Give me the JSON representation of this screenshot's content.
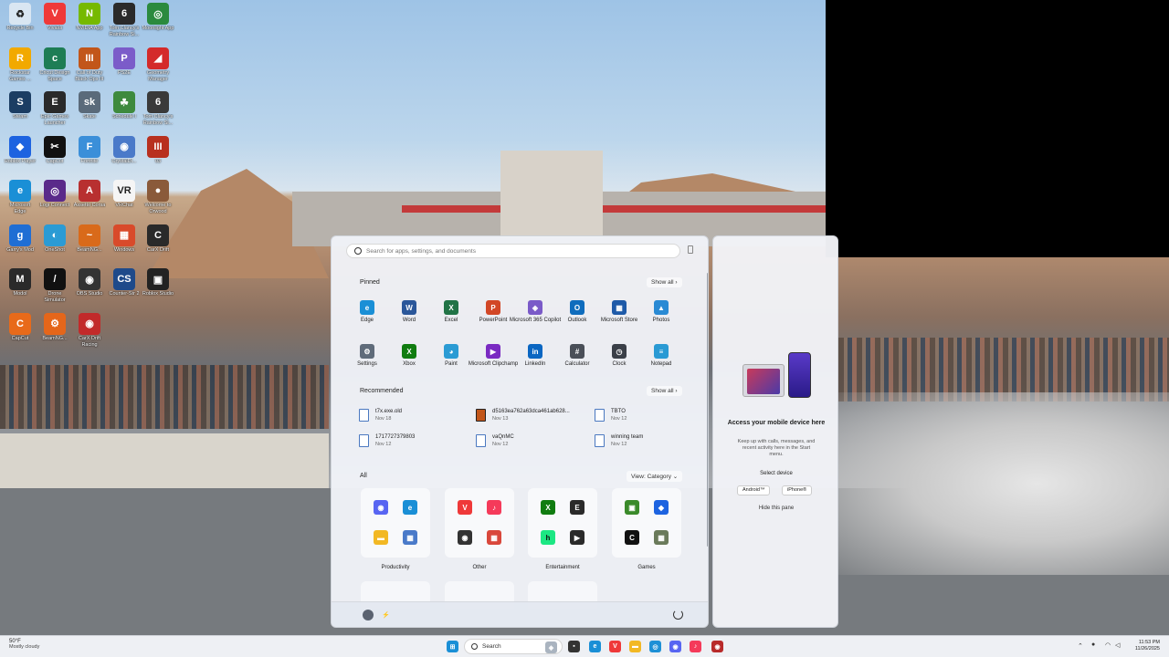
{
  "desktop": {
    "icons": [
      {
        "label": "Recycle Bin",
        "glyph": "♻",
        "color": "#d9e6f2",
        "icon": "recycle-bin-icon"
      },
      {
        "label": "Vivaldi",
        "glyph": "V",
        "color": "#ef3939",
        "icon": "vivaldi-icon"
      },
      {
        "label": "NVIDIA App",
        "glyph": "N",
        "color": "#76b900",
        "icon": "nvidia-icon"
      },
      {
        "label": "Tom Clancy's Rainbow Si...",
        "glyph": "6",
        "color": "#2a2a2a",
        "icon": "rainbow-six-icon"
      },
      {
        "label": "Moonlight App",
        "glyph": "◎",
        "color": "#2b8a3e",
        "icon": "moonlight-icon"
      },
      {
        "label": "Rockstar Games ...",
        "glyph": "R",
        "color": "#f2a900",
        "icon": "rockstar-icon"
      },
      {
        "label": "Cricut Design Space",
        "glyph": "c",
        "color": "#1e7d55",
        "icon": "cricut-icon"
      },
      {
        "label": "Call of Duty Black Ops III",
        "glyph": "III",
        "color": "#c2561a",
        "icon": "cod-icon"
      },
      {
        "label": "PS2E",
        "glyph": "P",
        "color": "#7b5cc9",
        "icon": "ps2e-icon"
      },
      {
        "label": "Geometry Manager",
        "glyph": "◢",
        "color": "#d42a2a",
        "icon": "geometry-icon"
      },
      {
        "label": "Steam",
        "glyph": "S",
        "color": "#1b3d63",
        "icon": "steam-icon"
      },
      {
        "label": "Epic Games Launcher",
        "glyph": "E",
        "color": "#2a2a2a",
        "icon": "epic-games-icon"
      },
      {
        "label": "Skate",
        "glyph": "sk",
        "color": "#5a6a7a",
        "icon": "skate-icon"
      },
      {
        "label": "Schedule I",
        "glyph": "☘",
        "color": "#3e8a3e",
        "icon": "schedule-icon"
      },
      {
        "label": "Tom Clancy's Rainbow Si...",
        "glyph": "6",
        "color": "#3a3a3a",
        "icon": "rainbow-six-icon-2"
      },
      {
        "label": "Roblox Player",
        "glyph": "◆",
        "color": "#1d63e0",
        "icon": "roblox-icon"
      },
      {
        "label": "CapCut",
        "glyph": "✂",
        "color": "#111111",
        "icon": "capcut-icon"
      },
      {
        "label": "Fortnite",
        "glyph": "F",
        "color": "#3b8fd9",
        "icon": "fortnite-icon"
      },
      {
        "label": "CrystalDi...",
        "glyph": "◉",
        "color": "#4a7ac9",
        "icon": "crystaldisk-icon"
      },
      {
        "label": "03",
        "glyph": "III",
        "color": "#b8301f",
        "icon": "ops-icon"
      },
      {
        "label": "Microsoft Edge",
        "glyph": "e",
        "color": "#1a8fd6",
        "icon": "edge-icon"
      },
      {
        "label": "Logi Connect",
        "glyph": "◎",
        "color": "#5a2a8a",
        "icon": "logi-icon"
      },
      {
        "label": "Assetto Corsa",
        "glyph": "A",
        "color": "#b83030",
        "icon": "assetto-icon"
      },
      {
        "label": "VRChat",
        "glyph": "VR",
        "color": "#f5f5f5",
        "icon": "vrchat-icon"
      },
      {
        "label": "Welcome to Orwood",
        "glyph": "●",
        "color": "#8a5a3a",
        "icon": "welcome-icon"
      },
      {
        "label": "Garry's Mod",
        "glyph": "g",
        "color": "#1f6ed4",
        "icon": "gmod-icon"
      },
      {
        "label": "OneShot",
        "glyph": "◐",
        "color": "#2b9bd4",
        "icon": "oneshot-icon"
      },
      {
        "label": "BeamNG...",
        "glyph": "~",
        "color": "#d96a1a",
        "icon": "beamng-icon"
      },
      {
        "label": "Windows",
        "glyph": "▦",
        "color": "#d94a2a",
        "icon": "windows-app-icon"
      },
      {
        "label": "CarX Drift",
        "glyph": "C",
        "color": "#2a2a2a",
        "icon": "carx-icon"
      },
      {
        "label": "Modol",
        "glyph": "M",
        "color": "#2a2a2a",
        "icon": "modol-icon"
      },
      {
        "label": "Drone Simulator",
        "glyph": "/",
        "color": "#111111",
        "icon": "drone-icon"
      },
      {
        "label": "OBS Studio",
        "glyph": "◉",
        "color": "#333333",
        "icon": "obs-icon"
      },
      {
        "label": "Counter-Str 2",
        "glyph": "CS",
        "color": "#1e4a8a",
        "icon": "cs2-icon"
      },
      {
        "label": "Roblox Studio",
        "glyph": "▣",
        "color": "#222222",
        "icon": "roblox-studio-icon"
      },
      {
        "label": "CapCut",
        "glyph": "C",
        "color": "#e86a1a",
        "icon": "capcut-2-icon"
      },
      {
        "label": "BeamNG...",
        "glyph": "⚙",
        "color": "#e5661a",
        "icon": "beamng-2-icon"
      },
      {
        "label": "CarX Drift Racing",
        "glyph": "◉",
        "color": "#c22a2a",
        "icon": "carx-drift-icon"
      }
    ]
  },
  "start_menu": {
    "search_placeholder": "Search for apps, settings, and documents",
    "pinned_title": "Pinned",
    "pinned_show_all": "Show all  ›",
    "pinned": [
      {
        "label": "Edge",
        "glyph": "e",
        "color": "#1a8fd6",
        "icon": "edge-icon"
      },
      {
        "label": "Word",
        "glyph": "W",
        "color": "#2b579a",
        "icon": "word-icon"
      },
      {
        "label": "Excel",
        "glyph": "X",
        "color": "#217346",
        "icon": "excel-icon"
      },
      {
        "label": "PowerPoint",
        "glyph": "P",
        "color": "#d24726",
        "icon": "powerpoint-icon"
      },
      {
        "label": "Microsoft 365 Copilot",
        "glyph": "◈",
        "color": "#7a5ac8",
        "icon": "copilot-icon"
      },
      {
        "label": "Outlook",
        "glyph": "O",
        "color": "#0f6cbd",
        "icon": "outlook-icon"
      },
      {
        "label": "Microsoft Store",
        "glyph": "▦",
        "color": "#1e5aa8",
        "icon": "store-icon"
      },
      {
        "label": "Photos",
        "glyph": "▲",
        "color": "#2a8ad4",
        "icon": "photos-icon"
      },
      {
        "label": "Settings",
        "glyph": "⚙",
        "color": "#5f6b7a",
        "icon": "settings-icon"
      },
      {
        "label": "Xbox",
        "glyph": "X",
        "color": "#107c10",
        "icon": "xbox-icon"
      },
      {
        "label": "Paint",
        "glyph": "◕",
        "color": "#2b9bd4",
        "icon": "paint-icon"
      },
      {
        "label": "Microsoft Clipchamp",
        "glyph": "▶",
        "color": "#7a2ac2",
        "icon": "clipchamp-icon"
      },
      {
        "label": "LinkedIn",
        "glyph": "in",
        "color": "#0a66c2",
        "icon": "linkedin-icon"
      },
      {
        "label": "Calculator",
        "glyph": "#",
        "color": "#4a4f58",
        "icon": "calculator-icon"
      },
      {
        "label": "Clock",
        "glyph": "◷",
        "color": "#3a3f48",
        "icon": "clock-icon"
      },
      {
        "label": "Notepad",
        "glyph": "≡",
        "color": "#2a9ad4",
        "icon": "notepad-icon"
      }
    ],
    "recommended_title": "Recommended",
    "recommended_show_all": "Show all  ›",
    "recommended": [
      {
        "name": "t7x.exe.old",
        "date": "Nov 18"
      },
      {
        "name": "d5163ea762a63dca461ab628...",
        "date": "Nov 13"
      },
      {
        "name": "TBTO",
        "date": "Nov 12"
      },
      {
        "name": "1717727379803",
        "date": "Nov 12"
      },
      {
        "name": "vaQnMC",
        "date": "Nov 12"
      },
      {
        "name": "winning team",
        "date": "Nov 12"
      }
    ],
    "all_title": "All",
    "view_label": "View: Category  ⌄",
    "categories": [
      {
        "label": "Productivity"
      },
      {
        "label": "Other"
      },
      {
        "label": "Entertainment"
      },
      {
        "label": "Games"
      }
    ]
  },
  "phone_panel": {
    "title": "Access your mobile device here",
    "description": "Keep up with calls, messages, and recent activity here in the Start menu.",
    "select_label": "Select device",
    "android_label": "Android™",
    "iphone_label": "iPhone®",
    "hide_label": "Hide this pane"
  },
  "taskbar": {
    "weather_temp": "50°F",
    "weather_desc": "Mostly cloudy",
    "search_label": "Search",
    "time": "11:53 PM",
    "date": "11/26/2025"
  }
}
